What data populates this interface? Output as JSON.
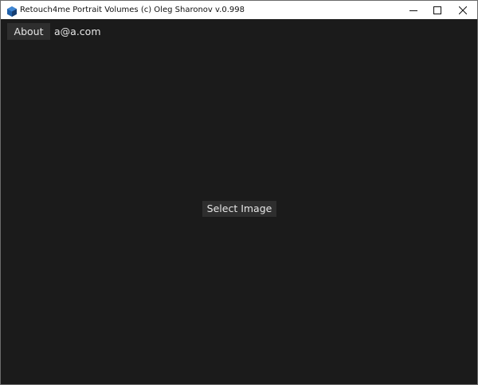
{
  "window": {
    "title": "Retouch4me Portrait Volumes (c) Oleg Sharonov v.0.998",
    "app_icon": "hexagon-app-icon",
    "controls": {
      "minimize_icon": "minimize-icon",
      "maximize_icon": "maximize-icon",
      "close_icon": "close-icon"
    }
  },
  "toolbar": {
    "about_label": "About",
    "user_email": "a@a.com"
  },
  "main": {
    "select_image_label": "Select Image"
  },
  "colors": {
    "background": "#1b1b1b",
    "button": "#2e2e2e",
    "text": "#e6e6e6",
    "titlebar": "#ffffff",
    "app_icon": "#1f5fa8"
  }
}
